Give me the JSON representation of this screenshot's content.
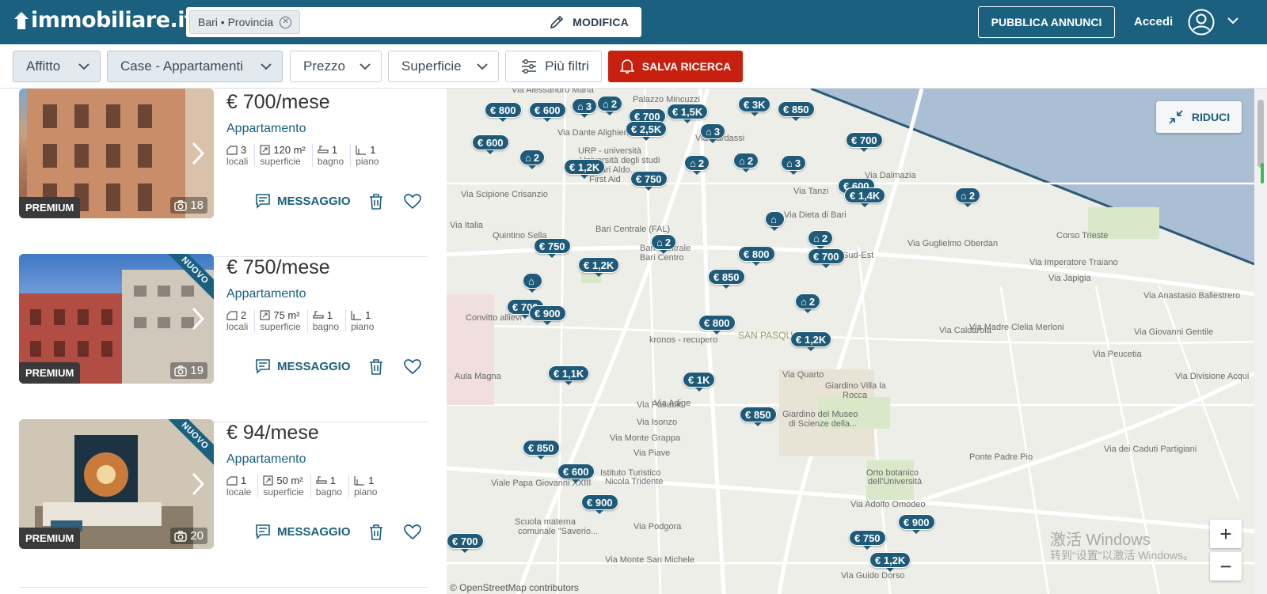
{
  "header": {
    "logo_text": "immobiliare.it",
    "search_chip": "Bari • Provincia",
    "modify_label": "MODIFICA",
    "publish_label": "PUBBLICA ANNUNCI",
    "login_label": "Accedi"
  },
  "filters": {
    "contract": "Affitto",
    "category": "Case - Appartamenti",
    "price": "Prezzo",
    "surface": "Superficie",
    "more": "Più filtri",
    "save": "SALVA RICERCA"
  },
  "listings": [
    {
      "price": "€ 700/mese",
      "type": "Appartamento",
      "badge": "PREMIUM",
      "photos": "18",
      "new": "",
      "rooms": "3",
      "rooms_label": "locali",
      "surface": "120 m²",
      "surface_label": "superficie",
      "baths": "1",
      "baths_label": "bagno",
      "floor": "1",
      "floor_label": "piano",
      "message_label": "MESSAGGIO"
    },
    {
      "price": "€ 750/mese",
      "type": "Appartamento",
      "badge": "PREMIUM",
      "photos": "19",
      "new": "NUOVO",
      "rooms": "2",
      "rooms_label": "locali",
      "surface": "75 m²",
      "surface_label": "superficie",
      "baths": "1",
      "baths_label": "bagno",
      "floor": "1",
      "floor_label": "piano",
      "message_label": "MESSAGGIO"
    },
    {
      "price": "€ 94/mese",
      "type": "Appartamento",
      "badge": "PREMIUM",
      "photos": "20",
      "new": "NUOVO",
      "rooms": "1",
      "rooms_label": "locale",
      "surface": "50 m²",
      "surface_label": "superficie",
      "baths": "1",
      "baths_label": "bagno",
      "floor": "1",
      "floor_label": "piano",
      "message_label": "MESSAGGIO"
    }
  ],
  "map": {
    "collapse_label": "RIDUCI",
    "zoom_in": "+",
    "zoom_out": "−",
    "attribution": "© OpenStreetMap contributors",
    "pins": [
      "€ 800",
      "€ 600",
      "3",
      "2",
      "€ 700",
      "€ 1,5K",
      "€ 3K",
      "€ 850",
      "€ 2,5K",
      "3",
      "€ 600",
      "2",
      "€ 1,2K",
      "€ 750",
      "2",
      "2",
      "3",
      "€ 700",
      "€ 600",
      "€ 1,4K",
      "2",
      "",
      "2",
      "€ 750",
      "2",
      "€ 1,2K",
      "€ 800",
      "€ 700",
      "€ 850",
      "",
      "€ 700",
      "€ 900",
      "2",
      "€ 800",
      "€ 1,2K",
      "€ 1,1K",
      "€ 1K",
      "€ 850",
      "€ 850",
      "€ 600",
      "€ 900",
      "€ 900",
      "€ 750",
      "€ 1,2K",
      "€ 700"
    ],
    "labels": [
      "Via Alessandro Maria",
      "Palazzo Mincuzzi",
      "Via Dante Alighieri",
      "URP - università",
      "Università degli studi",
      "di Bari Aldo...",
      "First Aid",
      "Via Cardassi",
      "Via Scipione Crisanzio",
      "Via Italia",
      "Quintino Sella",
      "Bari Centrale (FAL)",
      "Bari Centrale",
      "Bari Centro",
      "Via Dieta di Bari",
      "Via Tanzi",
      "Via Dalmazia",
      "Via Guglielmo Oberdan",
      "Corso Trieste",
      "Via Imperatore Traiano",
      "Via Japigia",
      "Via Anastasio Ballestrero",
      "Sud-Est",
      "Convitto allievi",
      "kronos - recupero",
      "SAN PASQUALE",
      "Via Quarto",
      "Giardino Villa la",
      "Rocca",
      "Giardino del Museo",
      "di Scienze della...",
      "Aula Magna",
      "Via Caldarola",
      "Via Peucetia",
      "Via Madre Clelia Merloni",
      "Via Giovanni Gentile",
      "Via Pasubio",
      "Via Isonzo",
      "Via Monte Grappa",
      "Via Piave",
      "Via Adige",
      "Istituto Turistico",
      "Nicola Tridente",
      "Viale Papa Giovanni XXIII",
      "Orto botanico",
      "dell'Università",
      "Ponte Padre Pio",
      "Via Adolfo Omodeo",
      "Scuola materna",
      "comunale \"Saverio...",
      "Via Podgora",
      "Via Monte San Michele",
      "Via Guido Dorso",
      "Via Divisione Acqui",
      "Via dei Caduti Partigiani"
    ]
  },
  "system": {
    "watermark_1": "激活 Windows",
    "watermark_2": "转到“设置”以激活 Windows。"
  },
  "colors": {
    "brand": "#1b607f",
    "save_red": "#c8200e",
    "pin": "#1f5b78"
  }
}
